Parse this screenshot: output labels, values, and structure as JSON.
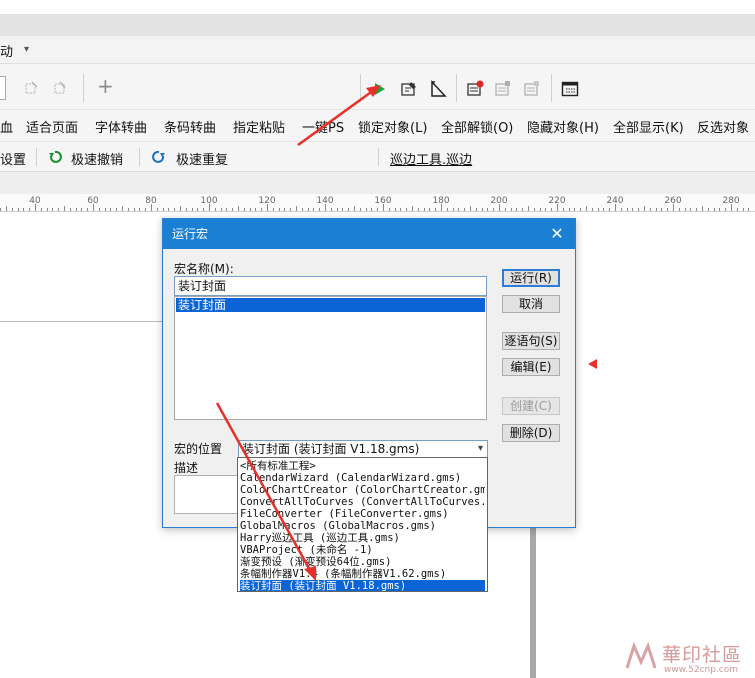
{
  "menubar": {
    "item": "动",
    "dropdown_glyph": "▾"
  },
  "toolbar1": {
    "plus_glyph": "+"
  },
  "toolbar2": {
    "items": [
      "血",
      "适合页面",
      "字体转曲",
      "条码转曲",
      "指定粘贴",
      "一键PS",
      "锁定对象(L)",
      "全部解锁(O)",
      "隐藏对象(H)",
      "全部显示(K)",
      "反选对象"
    ]
  },
  "toolbar3": {
    "settings": "设置",
    "undo": "极速撤销",
    "redo": "极速重复",
    "macro": "巡边工具.巡边"
  },
  "ruler": {
    "ticks": [
      "40",
      "60",
      "80",
      "100",
      "120",
      "140",
      "160",
      "180",
      "200",
      "220",
      "240",
      "260",
      "280"
    ]
  },
  "dialog": {
    "title": "运行宏",
    "close_glyph": "✕",
    "macro_name_label": "宏名称(M):",
    "macro_name_value": "装订封面",
    "macro_list": [
      "装订封面"
    ],
    "buttons": {
      "run": "运行(R)",
      "cancel": "取消",
      "step": "逐语句(S)",
      "edit": "编辑(E)",
      "create": "创建(C)",
      "delete": "删除(D)"
    },
    "location_label": "宏的位置",
    "location_value": "装订封面 (装订封面 V1.18.gms)",
    "description_label": "描述",
    "location_options": [
      "<所有标准工程>",
      "CalendarWizard (CalendarWizard.gms)",
      "ColorChartCreator (ColorChartCreator.gms)",
      "ConvertAllToCurves (ConvertAllToCurves.gms)",
      "FileConverter (FileConverter.gms)",
      "GlobalMacros (GlobalMacros.gms)",
      "Harry巡边工具 (巡边工具.gms)",
      "VBAProject (未命名 -1)",
      "渐变预设 (渐变预设64位.gms)",
      "条幅制作器V1.4 (条幅制作器V1.62.gms)",
      "装订封面 (装订封面 V1.18.gms)"
    ],
    "selected_option_index": 10
  },
  "watermark": {
    "text": "華印社區",
    "url": "www.52cnp.com"
  },
  "colors": {
    "accent": "#1b7fd4",
    "selection": "#0a64d6",
    "arrow": "#e8302a",
    "run_green": "#1aa23a"
  }
}
